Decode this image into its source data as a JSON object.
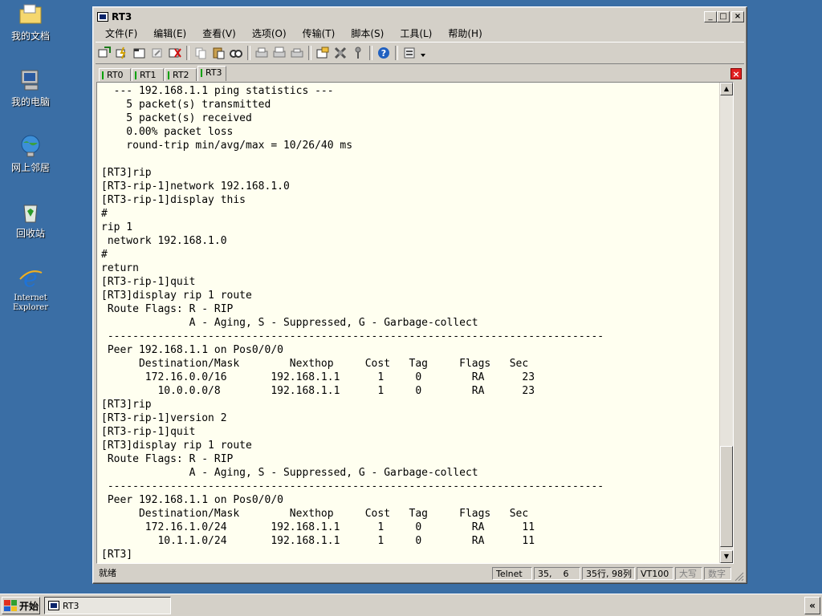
{
  "desktop": {
    "icons": [
      {
        "label": "我的文档",
        "icon": "folder-documents-icon"
      },
      {
        "label": "我的电脑",
        "icon": "my-computer-icon"
      },
      {
        "label": "网上邻居",
        "icon": "network-icon"
      },
      {
        "label": "回收站",
        "icon": "recycle-bin-icon"
      },
      {
        "label": "Internet\nExplorer",
        "icon": "internet-explorer-icon"
      }
    ]
  },
  "window": {
    "title": "RT3",
    "controls": {
      "minimize": "_",
      "maximize": "□",
      "close": "×"
    },
    "menu": [
      "文件(F)",
      "编辑(E)",
      "查看(V)",
      "选项(O)",
      "传输(T)",
      "脚本(S)",
      "工具(L)",
      "帮助(H)"
    ],
    "toolbar_icons": [
      "connect-icon",
      "quick-connect-icon",
      "connect-tab-icon",
      "reconnect-icon",
      "disconnect-icon",
      "copy-icon",
      "paste-icon",
      "find-icon",
      "print-setup-icon",
      "print-screen-icon",
      "print-icon",
      "session-options-icon",
      "settings-icon",
      "keymap-icon",
      "help-icon",
      "sftp-icon",
      "overflow-icon"
    ],
    "tabs": [
      "RT0",
      "RT1",
      "RT2",
      "RT3"
    ],
    "active_tab": "RT3",
    "tab_close": "×"
  },
  "terminal": {
    "lines": [
      "  --- 192.168.1.1 ping statistics ---",
      "    5 packet(s) transmitted",
      "    5 packet(s) received",
      "    0.00% packet loss",
      "    round-trip min/avg/max = 10/26/40 ms",
      "",
      "[RT3]rip",
      "[RT3-rip-1]network 192.168.1.0",
      "[RT3-rip-1]display this",
      "#",
      "rip 1",
      " network 192.168.1.0",
      "#",
      "return",
      "[RT3-rip-1]quit",
      "[RT3]display rip 1 route",
      " Route Flags: R - RIP",
      "              A - Aging, S - Suppressed, G - Garbage-collect",
      " -------------------------------------------------------------------------------",
      " Peer 192.168.1.1 on Pos0/0/0",
      "      Destination/Mask        Nexthop     Cost   Tag     Flags   Sec",
      "       172.16.0.0/16       192.168.1.1      1     0        RA      23",
      "         10.0.0.0/8        192.168.1.1      1     0        RA      23",
      "[RT3]rip",
      "[RT3-rip-1]version 2",
      "[RT3-rip-1]quit",
      "[RT3]display rip 1 route",
      " Route Flags: R - RIP",
      "              A - Aging, S - Suppressed, G - Garbage-collect",
      " -------------------------------------------------------------------------------",
      " Peer 192.168.1.1 on Pos0/0/0",
      "      Destination/Mask        Nexthop     Cost   Tag     Flags   Sec",
      "       172.16.1.0/24       192.168.1.1      1     0        RA      11",
      "         10.1.1.0/24       192.168.1.1      1     0        RA      11",
      "[RT3]"
    ]
  },
  "statusbar": {
    "ready": "就绪",
    "protocol": "Telnet",
    "cursor": "35,    6",
    "size": "35行, 98列",
    "emulation": "VT100",
    "caps": "大写",
    "num": "数字"
  },
  "taskbar": {
    "start": "开始",
    "task": "RT3",
    "tray": "«"
  },
  "colors": {
    "desktop": "#3a6ea5",
    "terminal_bg": "#fffff0",
    "chrome": "#d4d0c8"
  }
}
